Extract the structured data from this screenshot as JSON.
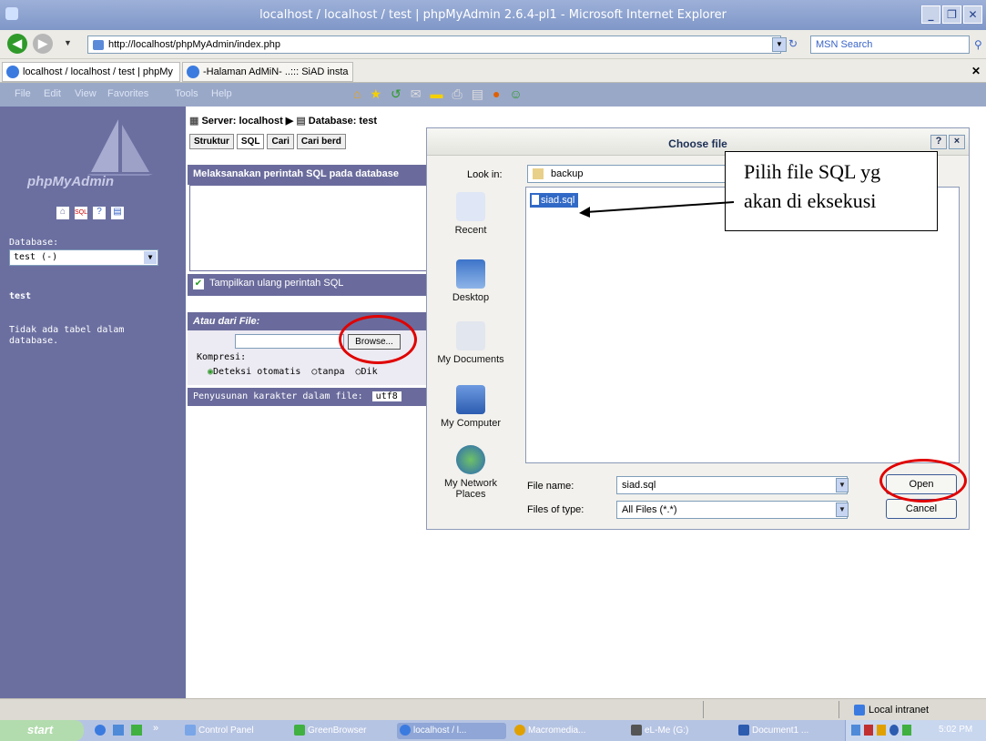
{
  "window": {
    "title": "localhost / localhost / test | phpMyAdmin 2.6.4-pl1 - Microsoft Internet Explorer"
  },
  "address": {
    "url": "http://localhost/phpMyAdmin/index.php",
    "search_placeholder": "MSN Search"
  },
  "tabs": [
    {
      "label": "localhost / localhost / test | phpMy"
    },
    {
      "label": "-Halaman AdMiN- ..::: SiAD insta"
    }
  ],
  "menu": [
    "File",
    "Edit",
    "View",
    "Favorites",
    "Tools",
    "Help"
  ],
  "sidebar": {
    "logo": "phpMyAdmin",
    "database_label": "Database:",
    "database_value": "test (-)",
    "current_db": "test",
    "empty_msg": "Tidak ada tabel dalam database."
  },
  "main": {
    "breadcrumb_server": "Server: localhost",
    "breadcrumb_db": "Database: test",
    "tabs": [
      "Struktur",
      "SQL",
      "Cari",
      "Cari berd"
    ],
    "sql_header": "Melaksanakan perintah SQL pada database",
    "show_again": "Tampilkan ulang perintah SQL",
    "file_header": "Atau dari File:",
    "browse": "Browse...",
    "compress_label": "Kompresi:",
    "compress_options": [
      "Deteksi otomatis",
      "tanpa",
      "Dik"
    ],
    "charset_label": "Penyusunan karakter dalam file:",
    "charset_value": "utf8"
  },
  "dialog": {
    "title": "Choose file",
    "lookin_label": "Look in:",
    "lookin_value": "backup",
    "places": [
      "Recent",
      "Desktop",
      "My Documents",
      "My Computer",
      "My Network Places"
    ],
    "file": "siad.sql",
    "filename_label": "File name:",
    "filename_value": "siad.sql",
    "filetype_label": "Files of type:",
    "filetype_value": "All Files (*.*)",
    "open": "Open",
    "cancel": "Cancel",
    "help": "?",
    "close": "×"
  },
  "annotation": {
    "line1": "Pilih file SQL yg",
    "line2": "akan di eksekusi"
  },
  "status": {
    "zone": "Local intranet"
  },
  "taskbar": {
    "start": "start",
    "items": [
      "Control Panel",
      "GreenBrowser",
      "localhost / l...",
      "Macromedia...",
      "eL-Me (G:)",
      "Document1 ..."
    ],
    "clock": "5:02 PM"
  },
  "colors": {
    "accent": "#6a6b9c",
    "highlight": "#e00000",
    "sidebar": "#6b6fa0"
  }
}
